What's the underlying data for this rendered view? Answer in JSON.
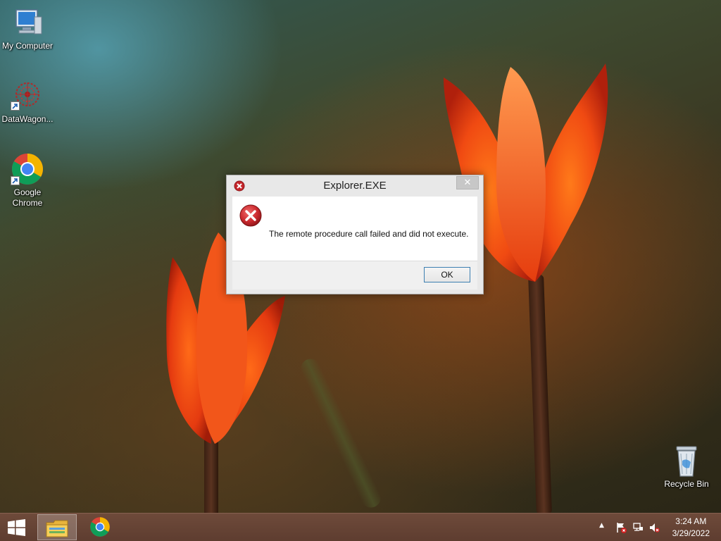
{
  "desktop": {
    "icons": [
      {
        "label": "My Computer",
        "icon": "computer-icon"
      },
      {
        "label": "DataWagon...",
        "icon": "datawagon-icon"
      },
      {
        "label": "Google\nChrome",
        "icon": "chrome-icon"
      },
      {
        "label": "Recycle Bin",
        "icon": "recycle-bin-icon"
      }
    ]
  },
  "dialog": {
    "title": "Explorer.EXE",
    "message": "The remote procedure call failed and did not execute.",
    "ok_label": "OK",
    "close_glyph": "✕"
  },
  "taskbar": {
    "items": [
      "file-explorer-icon",
      "chrome-icon"
    ],
    "tray": [
      "show-hidden-icons-icon",
      "action-center-flag-icon",
      "network-icon",
      "volume-muted-icon"
    ],
    "tray_arrow": "▲",
    "clock_time": "3:24 AM",
    "clock_date": "3/29/2022"
  },
  "colors": {
    "error_red": "#c5262b",
    "taskbar": "#6a4536",
    "ok_border": "#3c7fb1"
  }
}
